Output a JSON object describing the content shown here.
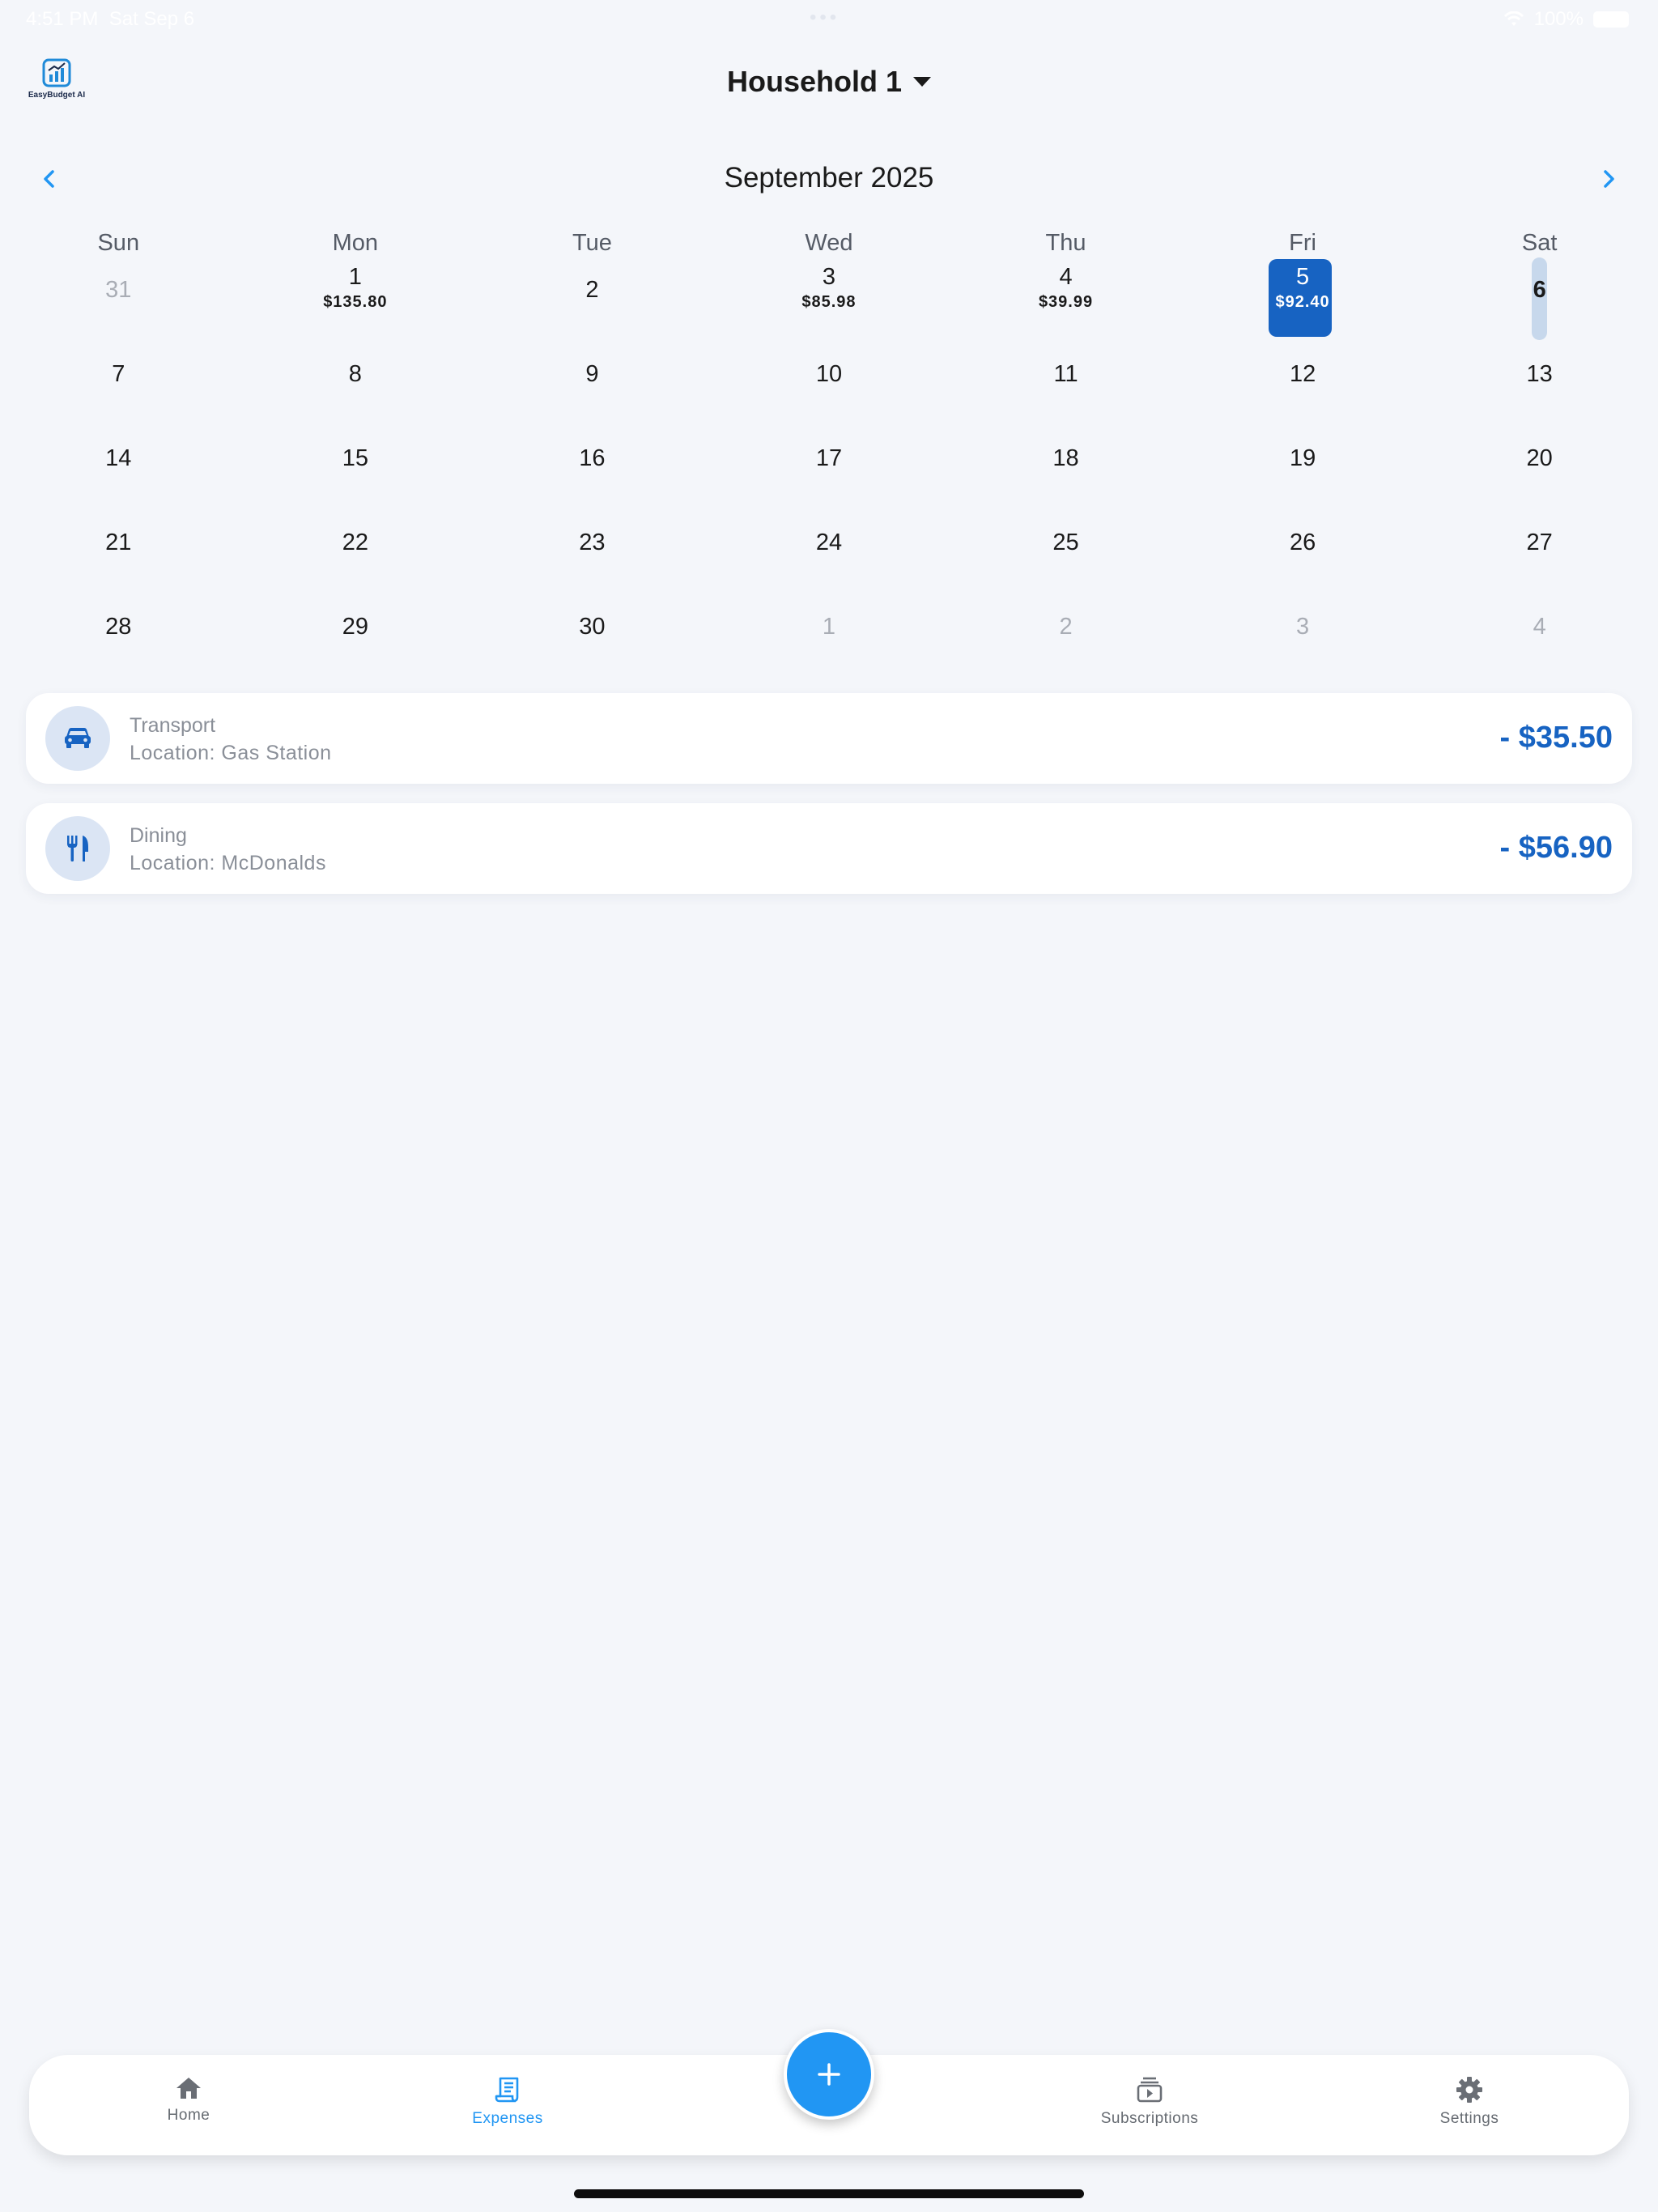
{
  "status_bar": {
    "time": "4:51 PM",
    "date": "Sat Sep 6",
    "dots": "•••",
    "battery": "100%"
  },
  "app": {
    "logo_text": "EasyBudget AI",
    "household": "Household 1"
  },
  "calendar": {
    "month_label": "September 2025",
    "weekdays": [
      "Sun",
      "Mon",
      "Tue",
      "Wed",
      "Thu",
      "Fri",
      "Sat"
    ],
    "weeks": [
      [
        {
          "day": "31",
          "amount": ""
        },
        {
          "day": "1",
          "amount": "$135.80"
        },
        {
          "day": "2",
          "amount": ""
        },
        {
          "day": "3",
          "amount": "$85.98"
        },
        {
          "day": "4",
          "amount": "$39.99"
        },
        {
          "day": "5",
          "amount": "$92.40"
        },
        {
          "day": "6",
          "amount": ""
        }
      ],
      [
        {
          "day": "7",
          "amount": ""
        },
        {
          "day": "8",
          "amount": ""
        },
        {
          "day": "9",
          "amount": ""
        },
        {
          "day": "10",
          "amount": ""
        },
        {
          "day": "11",
          "amount": ""
        },
        {
          "day": "12",
          "amount": ""
        },
        {
          "day": "13",
          "amount": ""
        }
      ],
      [
        {
          "day": "14",
          "amount": ""
        },
        {
          "day": "15",
          "amount": ""
        },
        {
          "day": "16",
          "amount": ""
        },
        {
          "day": "17",
          "amount": ""
        },
        {
          "day": "18",
          "amount": ""
        },
        {
          "day": "19",
          "amount": ""
        },
        {
          "day": "20",
          "amount": ""
        }
      ],
      [
        {
          "day": "21",
          "amount": ""
        },
        {
          "day": "22",
          "amount": ""
        },
        {
          "day": "23",
          "amount": ""
        },
        {
          "day": "24",
          "amount": ""
        },
        {
          "day": "25",
          "amount": ""
        },
        {
          "day": "26",
          "amount": ""
        },
        {
          "day": "27",
          "amount": ""
        }
      ],
      [
        {
          "day": "28",
          "amount": ""
        },
        {
          "day": "29",
          "amount": ""
        },
        {
          "day": "30",
          "amount": ""
        },
        {
          "day": "1",
          "amount": ""
        },
        {
          "day": "2",
          "amount": ""
        },
        {
          "day": "3",
          "amount": ""
        },
        {
          "day": "4",
          "amount": ""
        }
      ]
    ]
  },
  "expenses": [
    {
      "category": "Transport",
      "location": "Location: Gas Station",
      "amount": "- $35.50",
      "icon": "car-icon"
    },
    {
      "category": "Dining",
      "location": "Location: McDonalds",
      "amount": "- $56.90",
      "icon": "utensils-icon"
    }
  ],
  "bottom_nav": {
    "items": [
      {
        "label": "Home",
        "icon": "home-icon",
        "active": false
      },
      {
        "label": "Expenses",
        "icon": "receipt-icon",
        "active": true
      },
      {
        "label": "Subscriptions",
        "icon": "subscriptions-icon",
        "active": false
      },
      {
        "label": "Settings",
        "icon": "gear-icon",
        "active": false
      }
    ],
    "fab_icon": "plus-icon"
  },
  "colors": {
    "accent": "#2196f3",
    "selected_day": "#1763c2",
    "today_marker": "#c7d8ec",
    "background": "#f4f6fa"
  }
}
